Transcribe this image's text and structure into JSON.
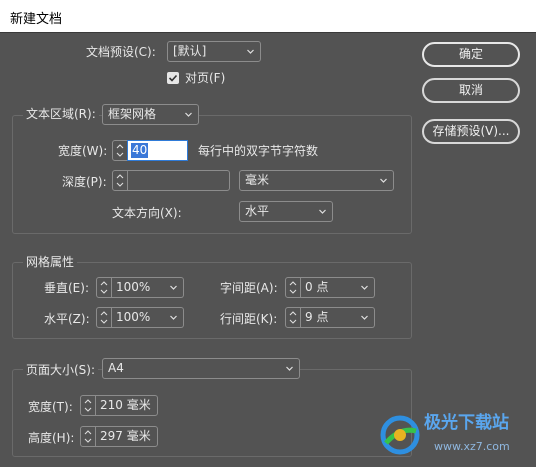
{
  "window": {
    "title": "新建文档"
  },
  "preset": {
    "label": "文档预设(C):",
    "value": "[默认]"
  },
  "facing_pages": {
    "label": "对页(F)",
    "checked": true
  },
  "text_area": {
    "label": "文本区域(R):",
    "value": "框架网格",
    "width_label": "宽度(W):",
    "width_value": "40",
    "width_suffix": "每行中的双字节字符数",
    "depth_label": "深度(P):",
    "depth_value": "",
    "depth_unit": "毫米",
    "direction_label": "文本方向(X):",
    "direction_value": "水平"
  },
  "grid": {
    "title": "网格属性",
    "vertical_label": "垂直(E):",
    "vertical_value": "100%",
    "horizontal_label": "水平(Z):",
    "horizontal_value": "100%",
    "char_spacing_label": "字间距(A):",
    "char_spacing_value": "0 点",
    "line_spacing_label": "行间距(K):",
    "line_spacing_value": "9 点"
  },
  "page_size": {
    "label": "页面大小(S):",
    "value": "A4",
    "width_label": "宽度(T):",
    "width_value": "210 毫米",
    "height_label": "高度(H):",
    "height_value": "297 毫米"
  },
  "buttons": {
    "ok": "确定",
    "cancel": "取消",
    "save_preset": "存储预设(V)..."
  },
  "watermark": {
    "text1": "极光下载站",
    "text2": "www.xz7.com"
  }
}
